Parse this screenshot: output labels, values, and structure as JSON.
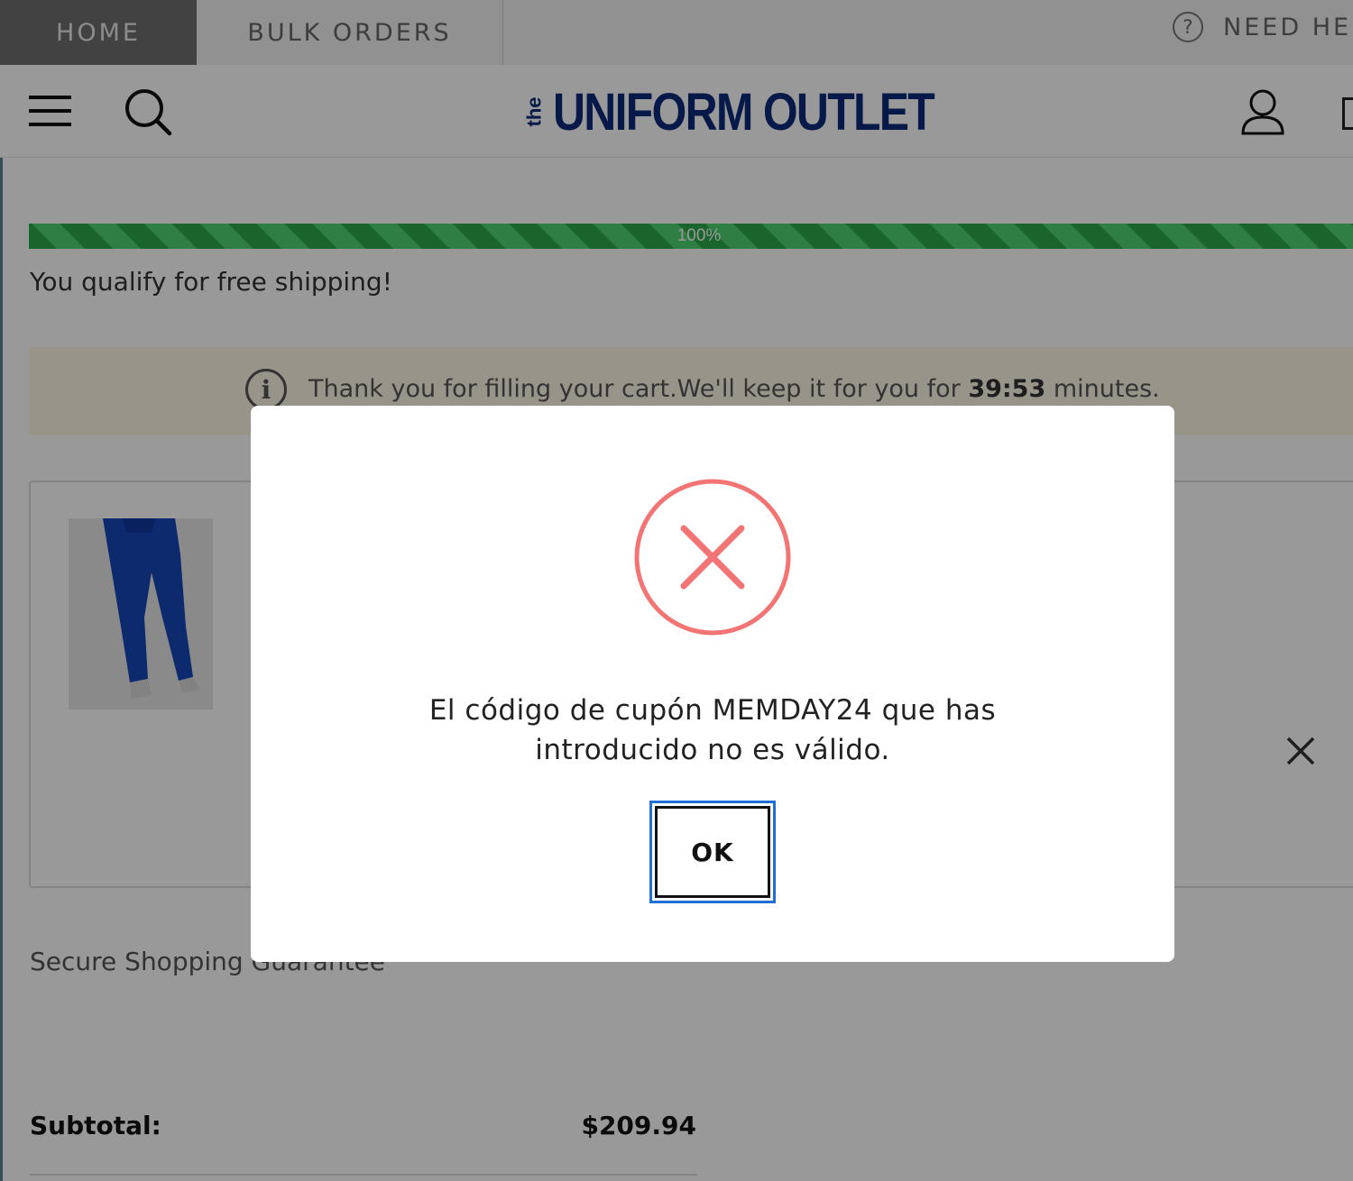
{
  "topbar": {
    "tabs": [
      {
        "label": "HOME"
      },
      {
        "label": "BULK ORDERS"
      }
    ],
    "help_label": "NEED HEL",
    "help_icon_glyph": "?"
  },
  "header": {
    "logo": {
      "the": "the",
      "name": "UNIFORM OUTLET"
    },
    "icons": [
      "menu-icon",
      "search-icon",
      "user-icon",
      "cart-icon"
    ]
  },
  "shipping": {
    "progress_percent": 100,
    "progress_label": "100%",
    "message": "You qualify for free shipping!"
  },
  "notice": {
    "icon_glyph": "i",
    "text_before": "Thank you for filling your cart.We'll keep it for you for ",
    "time": "39:53",
    "text_after": " minutes."
  },
  "cart": {
    "item_image": "blue scrub pants"
  },
  "footer": {
    "secure_text": "Secure Shopping Guarantee",
    "subtotal_label": "Subtotal:",
    "subtotal_value": "$209.94"
  },
  "modal": {
    "icon": "error-x-icon",
    "message": "El código de cupón MEMDAY24 que has introducido no es válido.",
    "ok_label": "OK"
  },
  "colors": {
    "brand": "#0b2b79",
    "progress": "#2aa84a",
    "error": "#f27474",
    "focus": "#1f6fd6",
    "notice_bg": "#fcf9e6"
  }
}
